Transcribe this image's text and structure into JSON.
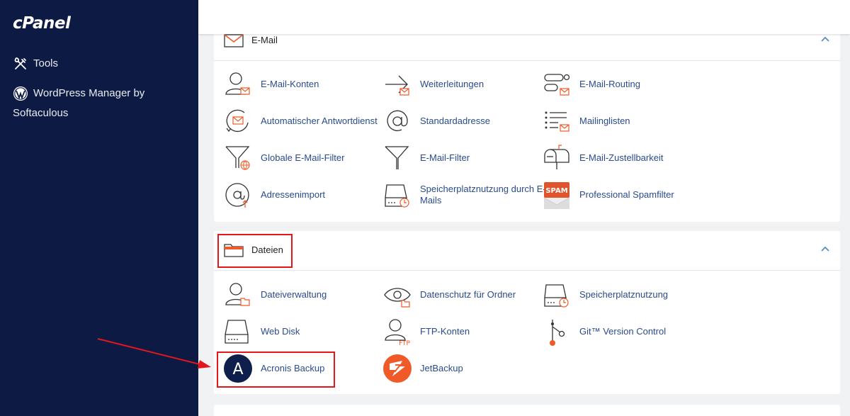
{
  "sidebar": {
    "logo": "cPanel",
    "items": [
      {
        "label": "Tools",
        "icon": "tools-icon"
      },
      {
        "label": "WordPress Manager by Softaculous",
        "icon": "wordpress-icon"
      }
    ]
  },
  "email_section": {
    "title": "E-Mail",
    "items": [
      {
        "label": "E-Mail-Konten"
      },
      {
        "label": "Weiterleitungen"
      },
      {
        "label": "E-Mail-Routing"
      },
      {
        "label": "Automatischer Antwortdienst"
      },
      {
        "label": "Standardadresse"
      },
      {
        "label": "Mailinglisten"
      },
      {
        "label": "Globale E-Mail-Filter"
      },
      {
        "label": "E-Mail-Filter"
      },
      {
        "label": "E-Mail-Zustellbarkeit"
      },
      {
        "label": "Adressenimport"
      },
      {
        "label": "Speicherplatznutzung durch E-Mails"
      },
      {
        "label": "Professional Spamfilter"
      }
    ],
    "spam_badge": "SPAM"
  },
  "files_section": {
    "title": "Dateien",
    "items": [
      {
        "label": "Dateiverwaltung"
      },
      {
        "label": "Datenschutz für Ordner"
      },
      {
        "label": "Speicherplatznutzung"
      },
      {
        "label": "Web Disk"
      },
      {
        "label": "FTP-Konten"
      },
      {
        "label": "Git™ Version Control"
      },
      {
        "label": "Acronis Backup"
      },
      {
        "label": "JetBackup"
      }
    ],
    "ftp_tag": "FTP",
    "acronis_letter": "A"
  },
  "colors": {
    "sidebar_bg": "#0d1b44",
    "link": "#2a4b8d",
    "accent_orange": "#f05a28",
    "highlight_red": "#e3161c"
  }
}
